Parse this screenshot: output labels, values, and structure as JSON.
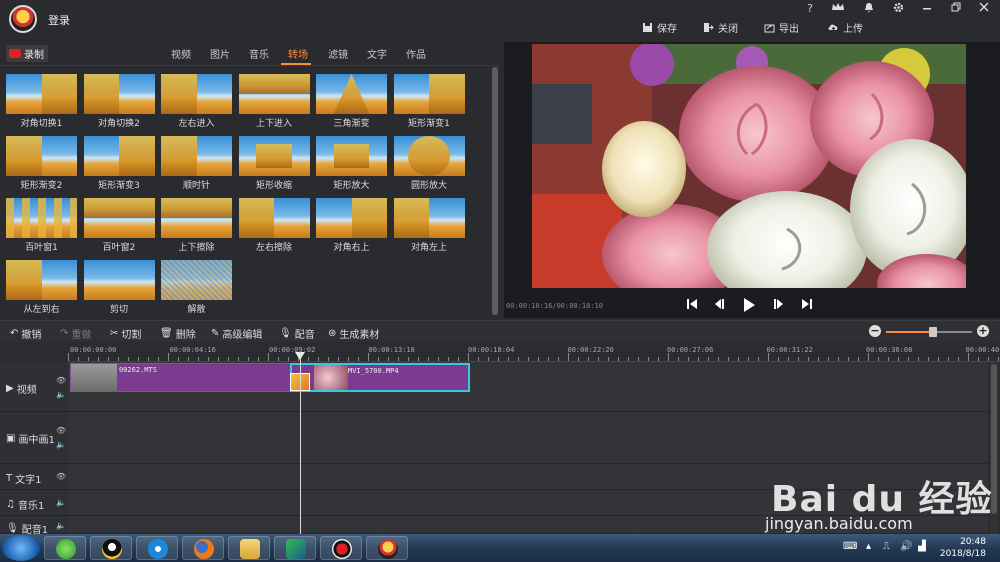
{
  "titlebar": {
    "login_label": "登录",
    "help": "?",
    "vip": "VIP",
    "actions": {
      "save": "保存",
      "close": "关闭",
      "export": "导出",
      "upload": "上传"
    }
  },
  "tabs": {
    "record": "录制",
    "items": [
      "视频",
      "图片",
      "音乐",
      "转场",
      "滤镜",
      "文字",
      "作品"
    ],
    "active": "转场"
  },
  "transitions": [
    "对角切换1",
    "对角切换2",
    "左右进入",
    "上下进入",
    "三角渐变",
    "矩形渐变1",
    "矩形渐变2",
    "矩形渐变3",
    "顺时针",
    "矩形收缩",
    "矩形放大",
    "圆形放大",
    "百叶窗1",
    "百叶窗2",
    "上下擦除",
    "左右擦除",
    "对角右上",
    "对角左上",
    "从左到右",
    "剪切",
    "解散"
  ],
  "preview": {
    "timecode": "00:00:10:16/00:00:18:10"
  },
  "toolbar": {
    "undo": "撤销",
    "redo": "重做",
    "cut": "切割",
    "delete": "删除",
    "advanced_edit": "高级编辑",
    "dub": "配音",
    "generate": "生成素材",
    "zoom_level": 0.55
  },
  "timeline": {
    "ticks": [
      "00:00:00:00",
      "00:00:04:16",
      "00:00:09:02",
      "00:00:13:18",
      "00:00:18:04",
      "00:00:22:20",
      "00:00:27:06",
      "00:00:31:22",
      "00:00:36:08",
      "00:00:40"
    ],
    "tracks": [
      "视频",
      "画中画1",
      "文字1",
      "音乐1",
      "配音1"
    ],
    "clips": [
      {
        "name": "00262.MTS"
      },
      {
        "name": "MVI_5700.MP4"
      }
    ]
  },
  "watermark": {
    "brand": "Bai du 经验",
    "url": "jingyan.baidu.com"
  },
  "taskbar": {
    "time": "20:48",
    "date": "2018/8/18"
  },
  "colors": {
    "accent": "#ff8a3c",
    "clip": "#7b3b8e",
    "selected_clip_border": "#35c8e0",
    "record": "#e02020"
  }
}
